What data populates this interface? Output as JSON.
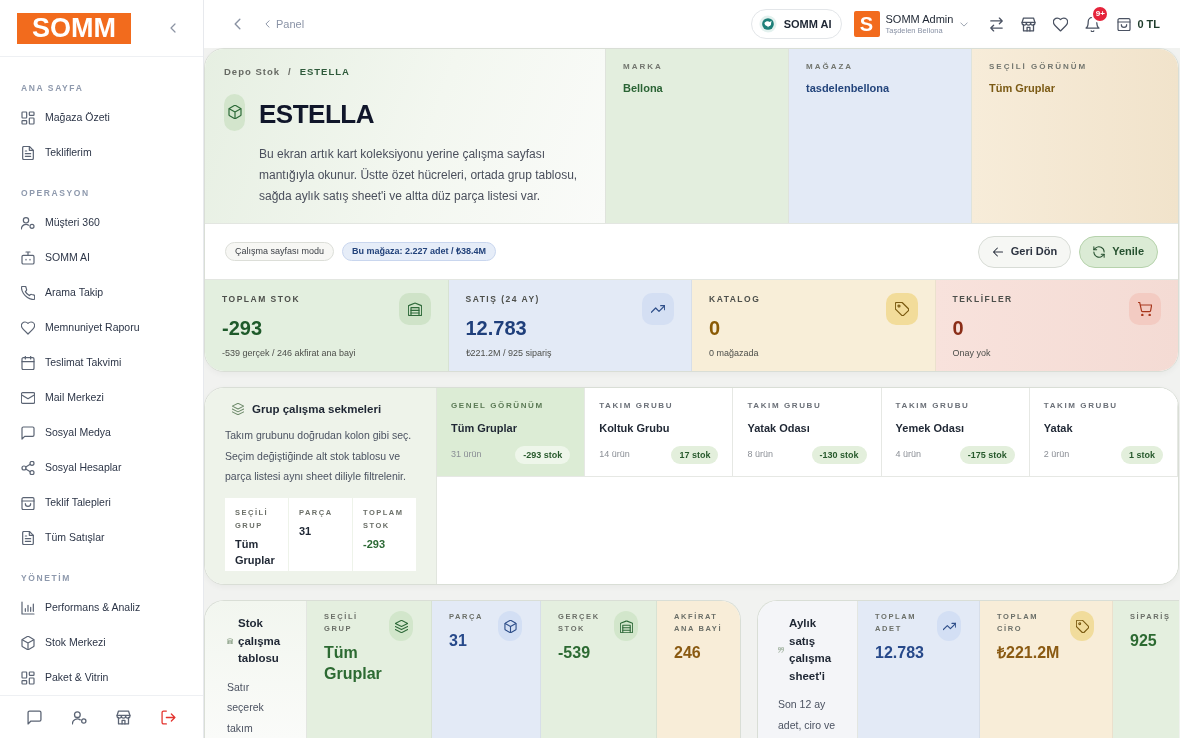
{
  "sidebar": {
    "logo": "SOMM",
    "sections": [
      {
        "title": "ANA SAYFA",
        "items": [
          "Mağaza Özeti",
          "Tekliflerim"
        ]
      },
      {
        "title": "OPERASYON",
        "items": [
          "Müşteri 360",
          "SOMM AI",
          "Arama Takip",
          "Memnuniyet Raporu",
          "Teslimat Takvimi",
          "Mail Merkezi",
          "Sosyal Medya",
          "Sosyal Hesaplar",
          "Teklif Talepleri",
          "Tüm Satışlar"
        ]
      },
      {
        "title": "YÖNETİM",
        "items": [
          "Performans & Analiz",
          "Stok Merkezi",
          "Paket & Vitrin"
        ]
      }
    ]
  },
  "top_bar": {
    "breadcrumb": "Panel",
    "ai_button": "SOMM AI",
    "user": {
      "initial": "S",
      "name": "SOMM Admin",
      "store": "Taşdelen Bellona"
    },
    "notification_count": "9+",
    "cart_total": "0 TL"
  },
  "header": {
    "breadcrumb": {
      "parent": "Depo Stok",
      "separator": "/",
      "current": "ESTELLA"
    },
    "title": "ESTELLA",
    "description": "Bu ekran artık kart koleksiyonu yerine çalışma sayfası mantığıyla okunur. Üstte özet hücreleri, ortada grup tablosu, sağda aylık satış sheet'i ve altta düz parça listesi var.",
    "info": [
      {
        "label": "MARKA",
        "value": "Bellona"
      },
      {
        "label": "MAĞAZA",
        "value": "tasdelenbellona"
      },
      {
        "label": "SEÇİLİ GÖRÜNÜM",
        "value": "Tüm Gruplar"
      }
    ],
    "chips": [
      {
        "kind": "mode",
        "label": "Çalışma sayfası modu"
      },
      {
        "kind": "info",
        "label": "Bu mağaza: 2.227 adet / ₺38.4M"
      }
    ],
    "buttons": [
      {
        "kind": "back",
        "label": "Geri Dön"
      },
      {
        "kind": "refresh",
        "label": "Yenile"
      }
    ]
  },
  "stats": [
    {
      "label": "TOPLAM STOK",
      "value": "-293",
      "note": "-539 gerçek / 246 akfirat ana bayi"
    },
    {
      "label": "SATIŞ (24 AY)",
      "value": "12.783",
      "note": "₺221.2M / 925 sipariş"
    },
    {
      "label": "KATALOG",
      "value": "0",
      "note": "0 mağazada"
    },
    {
      "label": "TEKLİFLER",
      "value": "0",
      "note": "Onay yok"
    }
  ],
  "group_panel": {
    "title": "Grup çalışma sekmeleri",
    "description": "Takım grubunu doğrudan kolon gibi seç. Seçim değiştiğinde alt stok tablosu ve parça listesi aynı sheet diliyle filtrelenir.",
    "summary": [
      {
        "label": "SEÇİLİ GRUP",
        "value": "Tüm Gruplar"
      },
      {
        "label": "PARÇA",
        "value": "31"
      },
      {
        "label": "TOPLAM STOK",
        "value": "-293"
      }
    ],
    "tabs": [
      {
        "kicker": "GENEL GÖRÜNÜM",
        "title": "Tüm Gruplar",
        "count": "31 ürün",
        "stock": "-293 stok",
        "selected": true
      },
      {
        "kicker": "TAKIM GRUBU",
        "title": "Koltuk Grubu",
        "count": "14 ürün",
        "stock": "17 stok",
        "selected": false
      },
      {
        "kicker": "TAKIM GRUBU",
        "title": "Yatak Odası",
        "count": "8 ürün",
        "stock": "-130 stok",
        "selected": false
      },
      {
        "kicker": "TAKIM GRUBU",
        "title": "Yemek Odası",
        "count": "4 ürün",
        "stock": "-175 stok",
        "selected": false
      },
      {
        "kicker": "TAKIM GRUBU",
        "title": "Yatak",
        "count": "2 ürün",
        "stock": "1 stok",
        "selected": false
      }
    ]
  },
  "stock_table": {
    "title": "Stok çalışma tablosu",
    "description": "Satır seçerek takım",
    "metrics": [
      {
        "label": "SEÇİLİ GRUP",
        "value": "Tüm Gruplar"
      },
      {
        "label": "PARÇA",
        "value": "31"
      },
      {
        "label": "GERÇEK STOK",
        "value": "-539"
      },
      {
        "label": "AKFİRAT ANA BAYİ",
        "value": "246"
      }
    ]
  },
  "sales_sheet": {
    "title": "Aylık satış çalışma sheet'i",
    "description": "Son 12 ay adet, ciro ve",
    "metrics": [
      {
        "label": "TOPLAM ADET",
        "value": "12.783"
      },
      {
        "label": "TOPLAM CİRO",
        "value": "₺221.2M"
      },
      {
        "label": "SİPARİŞ",
        "value": "925"
      }
    ]
  }
}
